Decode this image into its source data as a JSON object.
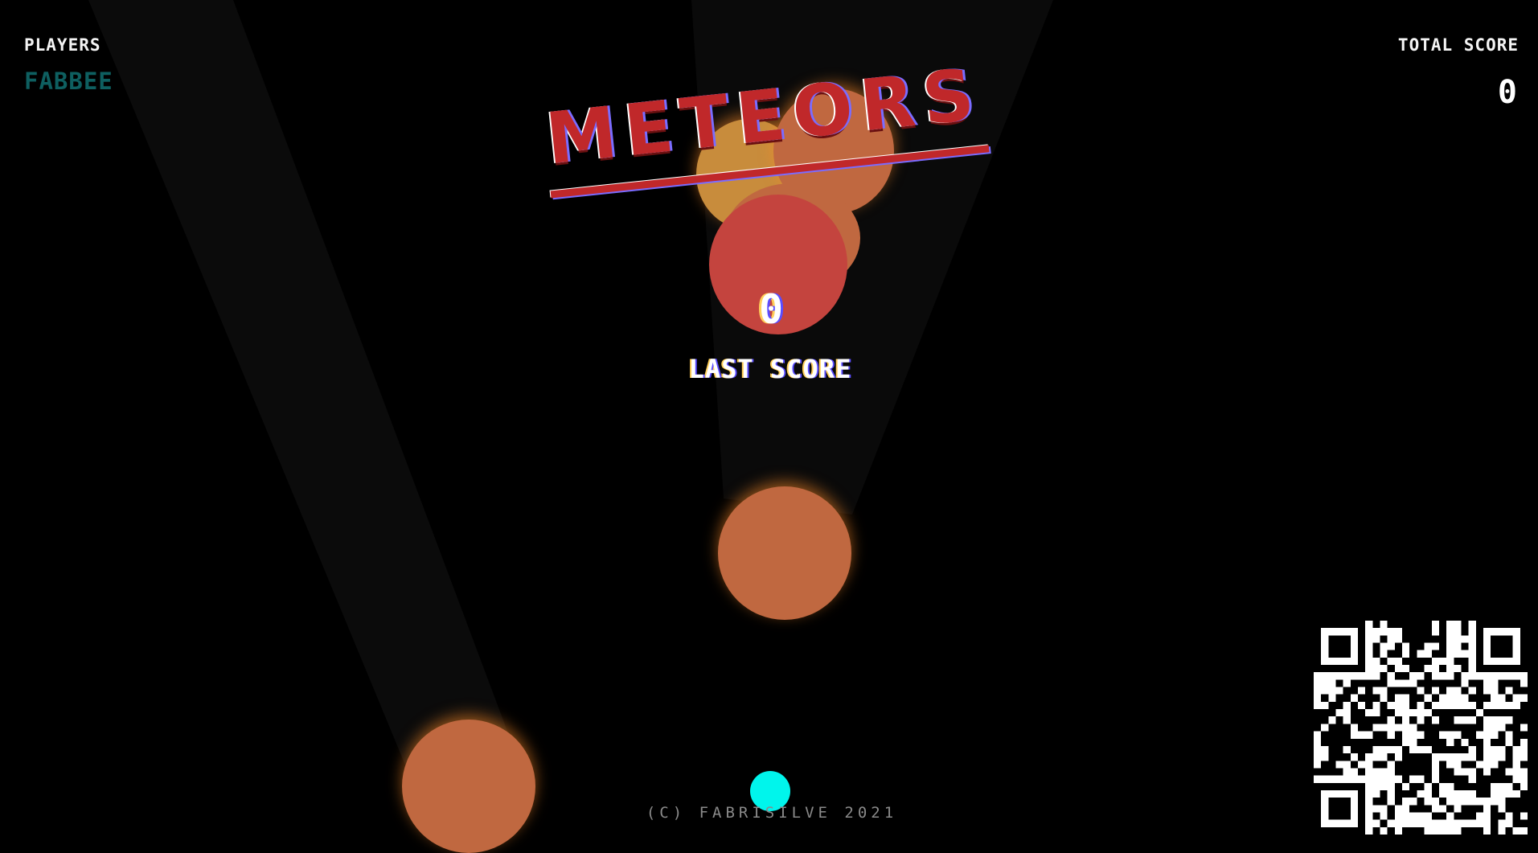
{
  "hud": {
    "players_label": "PLAYERS",
    "player_name": "FABBEE",
    "total_score_label": "TOTAL SCORE",
    "total_score_value": "0"
  },
  "title": {
    "text": "METEORS",
    "color": "#c0282a"
  },
  "last_score": {
    "value": "0",
    "label": "LAST SCORE"
  },
  "footer": {
    "copyright": "(C) FABRISILVE 2021"
  },
  "colors": {
    "background": "#000000",
    "player_ship": "#00f5ec",
    "meteor_orange": "#c06840",
    "meteor_red": "#c4443e",
    "meteor_gold": "#c88c3c",
    "player_name": "#0e5f60"
  },
  "icons": {
    "qr_code": "qr-code-icon"
  }
}
